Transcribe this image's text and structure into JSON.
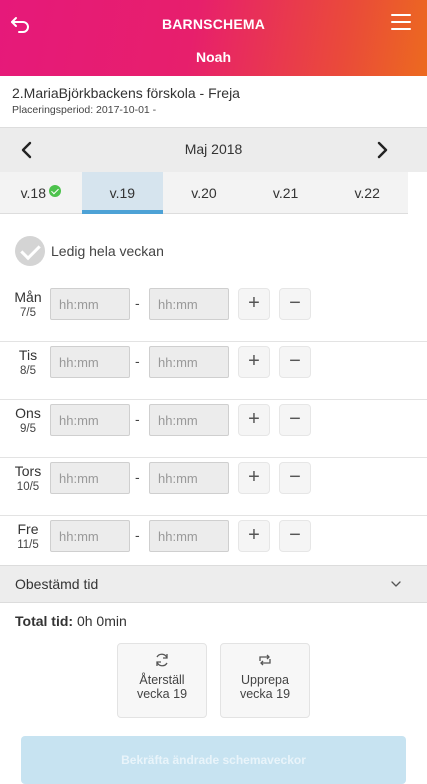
{
  "header": {
    "title": "BARNSCHEMA",
    "child_name": "Noah",
    "gradient": [
      "#e6197a",
      "#ec6a1f"
    ]
  },
  "school": {
    "name": "2.MariaBjörkbackens förskola - Freja",
    "placement_period": "Placeringsperiod: 2017-10-01 -"
  },
  "month_nav": {
    "month": "Maj 2018"
  },
  "weeks": [
    {
      "label": "v.18",
      "confirmed": true
    },
    {
      "label": "v.19",
      "active": true
    },
    {
      "label": "v.20"
    },
    {
      "label": "v.21"
    },
    {
      "label": "v.22"
    }
  ],
  "free_week": {
    "label": "Ledig hela veckan",
    "checked": false
  },
  "time_placeholder": "hh:mm",
  "separator": "-",
  "plus": "+",
  "minus": "−",
  "days": [
    {
      "name": "Mån",
      "date": "7/5"
    },
    {
      "name": "Tis",
      "date": "8/5"
    },
    {
      "name": "Ons",
      "date": "9/5"
    },
    {
      "name": "Tors",
      "date": "10/5"
    },
    {
      "name": "Fre",
      "date": "11/5"
    }
  ],
  "undecided": {
    "label": "Obestämd tid"
  },
  "total": {
    "label": "Total tid:",
    "value": "0h 0min"
  },
  "actions": {
    "reset": {
      "line1": "Återställ",
      "line2": "vecka 19"
    },
    "repeat": {
      "line1": "Upprepa",
      "line2": "vecka 19"
    }
  },
  "confirm_button": "Bekräfta ändrade schemaveckor",
  "colors": {
    "accent_blue": "#4da2d6",
    "confirm_bg": "#c7e3f1",
    "check_green": "#4cc24c"
  }
}
